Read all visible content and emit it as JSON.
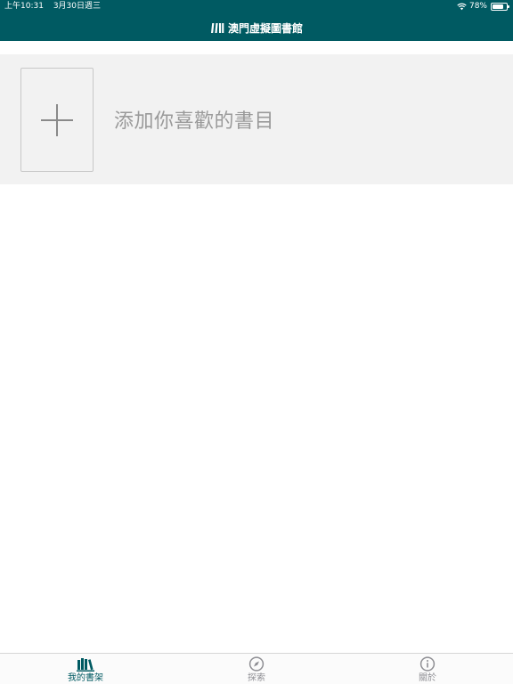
{
  "status_bar": {
    "time": "上午10:31",
    "date": "3月30日週三",
    "battery_percent": "78%",
    "battery_level": 0.78,
    "wifi_icon": "wifi-icon",
    "battery_icon": "battery-icon"
  },
  "nav": {
    "title": "澳門虛擬圖書館",
    "logo_icon": "library-logo-icon"
  },
  "add_book": {
    "label": "添加你喜歡的書目",
    "icon": "plus-icon"
  },
  "tabs": [
    {
      "label": "我的書架",
      "icon": "bookshelf-icon",
      "active": true
    },
    {
      "label": "探索",
      "icon": "compass-icon",
      "active": false
    },
    {
      "label": "關於",
      "icon": "info-icon",
      "active": false
    }
  ],
  "colors": {
    "brand": "#005a62",
    "inactive_tab": "#8e8e93",
    "panel_bg": "#f2f2f2",
    "placeholder_text": "#9a9a9a"
  }
}
